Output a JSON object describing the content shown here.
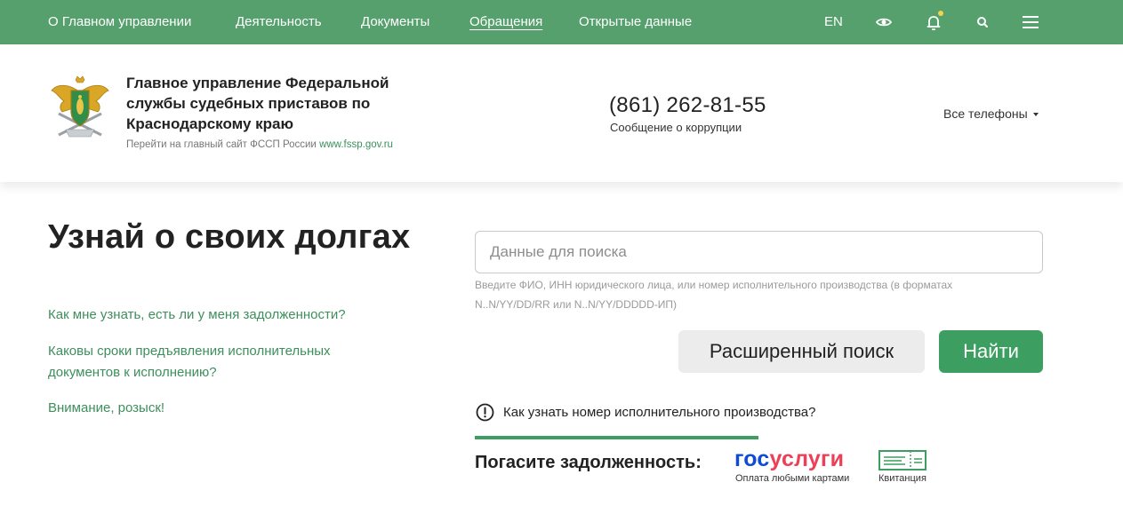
{
  "nav": {
    "items": [
      "О Главном управлении",
      "Деятельность",
      "Документы",
      "Обращения",
      "Открытые данные"
    ],
    "lang": "EN"
  },
  "icons": {
    "eye": "eye-icon",
    "bell": "bell-icon",
    "search": "search-icon",
    "menu": "menu-icon",
    "emblem": "fssp-emblem-icon",
    "info": "exclamation-circle-icon",
    "receipt": "receipt-icon"
  },
  "colors": {
    "nav_bg": "#55a06c",
    "accent_green": "#3d9e61",
    "gos_blue": "#0d4cd3",
    "gos_red": "#ee3f58",
    "notification_dot": "#f2d34b"
  },
  "header": {
    "org_name": "Главное управление Федеральной службы судебных приставов по Краснодарскому краю",
    "main_site_text": "Перейти на главный сайт ФССП России",
    "main_site_link": "www.fssp.gov.ru",
    "phone": "(861) 262-81-55",
    "phone_caption": "Сообщение о коррупции",
    "all_phones": "Все телефоны"
  },
  "main": {
    "title": "Узнай о своих долгах",
    "links": [
      "Как мне узнать, есть ли у меня задолженности?",
      "Каковы сроки предъявления исполнительных документов к исполнению?",
      "Внимание, розыск!"
    ],
    "search": {
      "placeholder": "Данные для поиска",
      "hint": "Введите ФИО, ИНН юридического лица, или номер исполнительного производства (в форматах N..N/YY/DD/RR или N..N/YY/DDDDD-ИП)",
      "advanced_button": "Расширенный поиск",
      "find_button": "Найти"
    },
    "how_to_find": "Как узнать номер исполнительного производства?",
    "pay": {
      "label": "Погасите задолженность:",
      "gosuslugi_part1": "гос",
      "gosuslugi_part2": "услуги",
      "gosuslugi_caption": "Оплата любыми картами",
      "receipt_caption": "Квитанция"
    }
  }
}
